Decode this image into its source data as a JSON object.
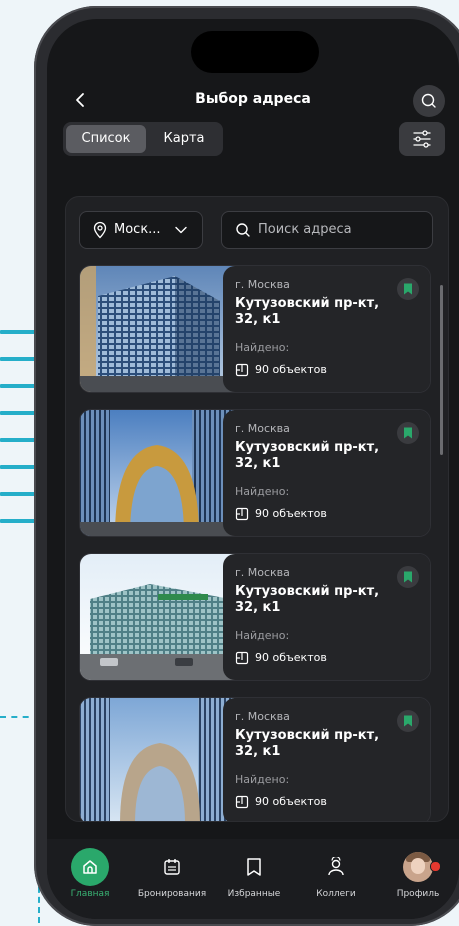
{
  "header": {
    "title": "Выбор адреса"
  },
  "view_toggle": {
    "list_label": "Список",
    "map_label": "Карта",
    "selected": "list"
  },
  "filters": {
    "city_value": "Моск...",
    "search_placeholder": "Поиск адреса"
  },
  "listings": [
    {
      "city": "г. Москва",
      "address": "Кутузовский пр-кт, 32, к1",
      "found_label": "Найдено:",
      "count": "90 объектов",
      "bookmarked": true
    },
    {
      "city": "г. Москва",
      "address": "Кутузовский пр-кт, 32, к1",
      "found_label": "Найдено:",
      "count": "90 объектов",
      "bookmarked": true
    },
    {
      "city": "г. Москва",
      "address": "Кутузовский пр-кт, 32, к1",
      "found_label": "Найдено:",
      "count": "90 объектов",
      "bookmarked": true
    },
    {
      "city": "г. Москва",
      "address": "Кутузовский пр-кт, 32, к1",
      "found_label": "Найдено:",
      "count": "90 объектов",
      "bookmarked": true
    }
  ],
  "tabbar": {
    "items": [
      {
        "label": "Главная",
        "icon": "home-icon",
        "active": true
      },
      {
        "label": "Бронирования",
        "icon": "calendar-icon",
        "active": false
      },
      {
        "label": "Избранные",
        "icon": "bookmark-icon",
        "active": false
      },
      {
        "label": "Коллеги",
        "icon": "colleagues-icon",
        "active": false
      },
      {
        "label": "Профиль",
        "icon": "avatar",
        "active": false
      }
    ]
  },
  "colors": {
    "accent": "#2aa86b",
    "background": "#161719",
    "card": "#242528",
    "decor": "#25aec9"
  }
}
